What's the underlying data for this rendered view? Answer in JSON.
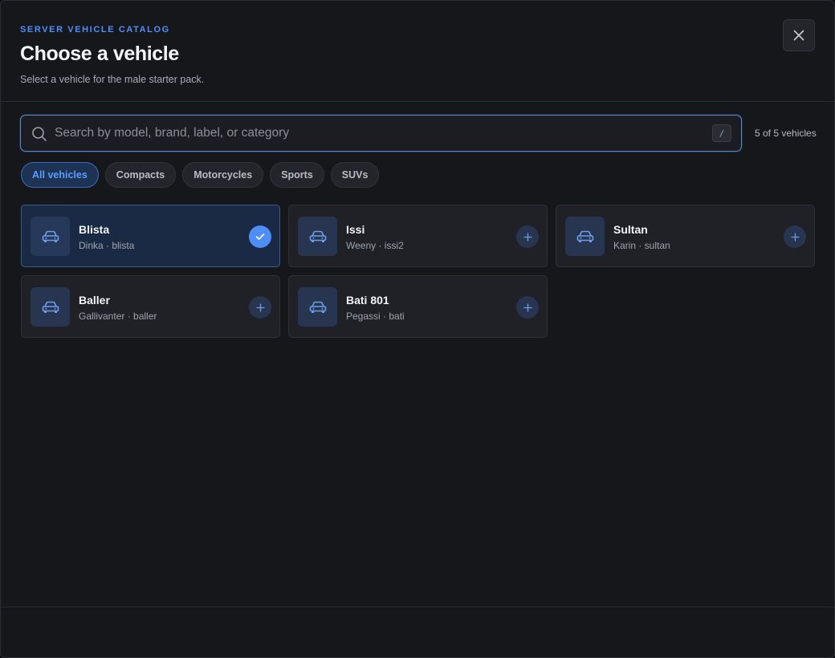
{
  "header": {
    "eyebrow": "SERVER VEHICLE CATALOG",
    "title": "Choose a vehicle",
    "subtitle": "Select a vehicle for the male starter pack.",
    "close_icon": "close-icon"
  },
  "search": {
    "placeholder": "Search by model, brand, label, or category",
    "value": "",
    "shortcut": "/",
    "icon": "search-icon"
  },
  "result_count": "5 of 5 vehicles",
  "filters": [
    {
      "label": "All vehicles",
      "active": true
    },
    {
      "label": "Compacts",
      "active": false
    },
    {
      "label": "Motorcycles",
      "active": false
    },
    {
      "label": "Sports",
      "active": false
    },
    {
      "label": "SUVs",
      "active": false
    }
  ],
  "vehicles": [
    {
      "name": "Blista",
      "meta": "Dinka · blista",
      "selected": true
    },
    {
      "name": "Issi",
      "meta": "Weeny · issi2",
      "selected": false
    },
    {
      "name": "Sultan",
      "meta": "Karin · sultan",
      "selected": false
    },
    {
      "name": "Baller",
      "meta": "Gallivanter · baller",
      "selected": false
    },
    {
      "name": "Bati 801",
      "meta": "Pegassi · bati",
      "selected": false
    }
  ],
  "icons": {
    "vehicle": "car-icon",
    "selected": "check-icon",
    "add": "plus-icon"
  },
  "colors": {
    "accent": "#4f8ef7",
    "background": "#16171b",
    "card": "#1f2126",
    "selected_card": "#1a2a44"
  }
}
